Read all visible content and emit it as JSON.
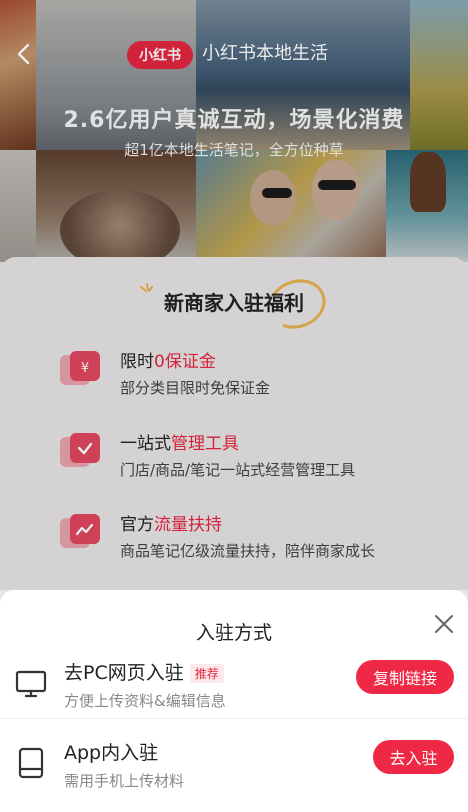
{
  "hero": {
    "brand_badge": "小红书",
    "title": "小红书本地生活",
    "headline": "2.6亿用户真诚互动，场景化消费",
    "subheadline": "超1亿本地生活笔记，全方位种草"
  },
  "benefits": {
    "title": "新商家入驻福利",
    "items": [
      {
        "title_prefix": "限时",
        "title_highlight": "0保证金",
        "desc": "部分类目限时免保证金",
        "icon": "yuan-icon"
      },
      {
        "title_prefix": "一站式",
        "title_highlight": "管理工具",
        "desc": "门店/商品/笔记一站式经营管理工具",
        "icon": "check-icon"
      },
      {
        "title_prefix": "官方",
        "title_highlight": "流量扶持",
        "desc": "商品笔记亿级流量扶持，陪伴商家成长",
        "icon": "trend-icon"
      }
    ]
  },
  "sheet": {
    "title": "入驻方式",
    "options": [
      {
        "title": "去PC网页入驻",
        "tag": "推荐",
        "desc": "方便上传资料&编辑信息",
        "button": "复制链接",
        "icon": "monitor-icon"
      },
      {
        "title": "App内入驻",
        "tag": "",
        "desc": "需用手机上传材料",
        "button": "去入驻",
        "icon": "tablet-icon"
      }
    ]
  },
  "colors": {
    "accent": "#ef2945",
    "brand": "#e5263f",
    "highlight_ring": "#e8b24c"
  }
}
